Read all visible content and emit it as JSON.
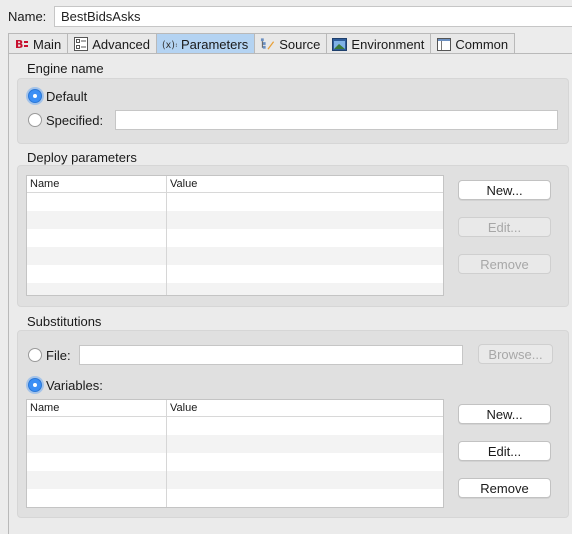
{
  "header": {
    "name_label": "Name:",
    "name_value": "BestBidsAsks"
  },
  "tabs": [
    {
      "label": "Main",
      "icon": "main-icon",
      "active": false
    },
    {
      "label": "Advanced",
      "icon": "advanced-icon",
      "active": false
    },
    {
      "label": "Parameters",
      "icon": "parameters-icon",
      "active": true
    },
    {
      "label": "Source",
      "icon": "source-icon",
      "active": false
    },
    {
      "label": "Environment",
      "icon": "environment-icon",
      "active": false
    },
    {
      "label": "Common",
      "icon": "common-icon",
      "active": false
    }
  ],
  "engine": {
    "title": "Engine name",
    "default_label": "Default",
    "default_checked": true,
    "specified_label": "Specified:",
    "specified_value": ""
  },
  "deploy": {
    "title": "Deploy parameters",
    "columns": [
      "Name",
      "Value"
    ],
    "rows": [],
    "buttons": {
      "new": "New...",
      "edit": "Edit...",
      "remove": "Remove"
    },
    "edit_enabled": false,
    "remove_enabled": false
  },
  "substitutions": {
    "title": "Substitutions",
    "file_label": "File:",
    "file_value": "",
    "file_checked": false,
    "browse_label": "Browse...",
    "variables_label": "Variables:",
    "variables_checked": true,
    "columns": [
      "Name",
      "Value"
    ],
    "rows": [],
    "buttons": {
      "new": "New...",
      "edit": "Edit...",
      "remove": "Remove"
    }
  },
  "colors": {
    "active_tab": "#b4d3f2",
    "radio_selected": "#3c8ff5",
    "panel_background": "#ececec"
  }
}
